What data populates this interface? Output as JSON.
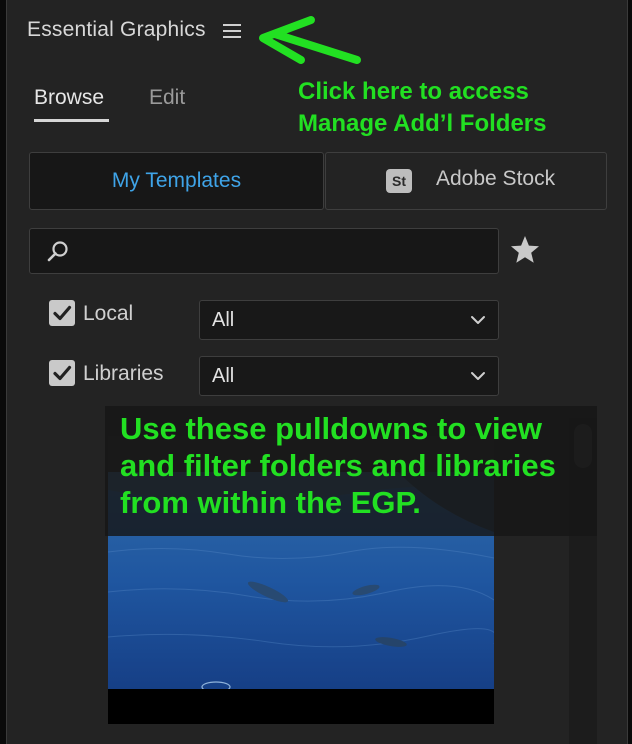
{
  "panel": {
    "title": "Essential Graphics",
    "menu_icon": "hamburger-icon"
  },
  "tabs": {
    "browse": "Browse",
    "edit": "Edit",
    "active": "Browse"
  },
  "source_toggle": {
    "my_templates": "My Templates",
    "adobe_stock_badge": "St",
    "adobe_stock": "Adobe Stock",
    "selected": "My Templates"
  },
  "search": {
    "value": "",
    "placeholder": "",
    "icon": "search-icon"
  },
  "favorite_icon": "star-icon",
  "filters": {
    "local": {
      "label": "Local",
      "checked": true,
      "selected": "All"
    },
    "libraries": {
      "label": "Libraries",
      "checked": true,
      "selected": "All"
    }
  },
  "annotations": {
    "top_line1": "Click here to access",
    "top_line2": "Manage Add’l Folders",
    "main_line1": "Use these pulldowns to view",
    "main_line2": "and filter folders and libraries",
    "main_line3": "from within the EGP."
  },
  "colors": {
    "accent_blue": "#3fa4e8",
    "annotation_green": "#22e022",
    "panel_bg": "#232323"
  }
}
